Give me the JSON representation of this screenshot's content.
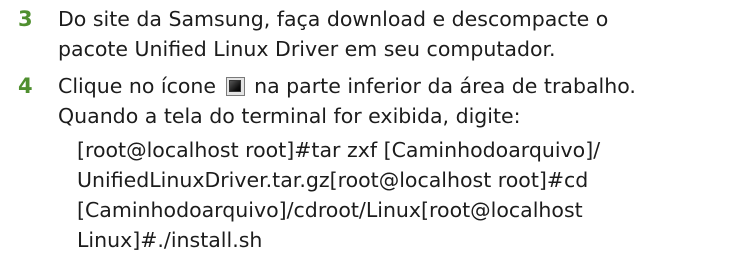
{
  "steps": [
    {
      "number": "3",
      "lines": [
        "Do site da Samsung, faça download e descompacte o",
        "pacote Unified Linux Driver em seu computador."
      ]
    },
    {
      "number": "4",
      "line1_before_icon": "Clique no ícone",
      "line1_after_icon": "na parte inferior da área de trabalho.",
      "line2": "Quando a tela do terminal for exibida, digite:",
      "icon": "terminal-icon",
      "command_lines": [
        "[root@localhost root]#tar zxf [Caminhodoarquivo]/",
        "UnifiedLinuxDriver.tar.gz[root@localhost root]#cd",
        "[Caminhodoarquivo]/cdroot/Linux[root@localhost",
        "Linux]#./install.sh"
      ]
    }
  ],
  "colors": {
    "step_number": "#4f8f2f",
    "text": "#1c1c1c"
  }
}
